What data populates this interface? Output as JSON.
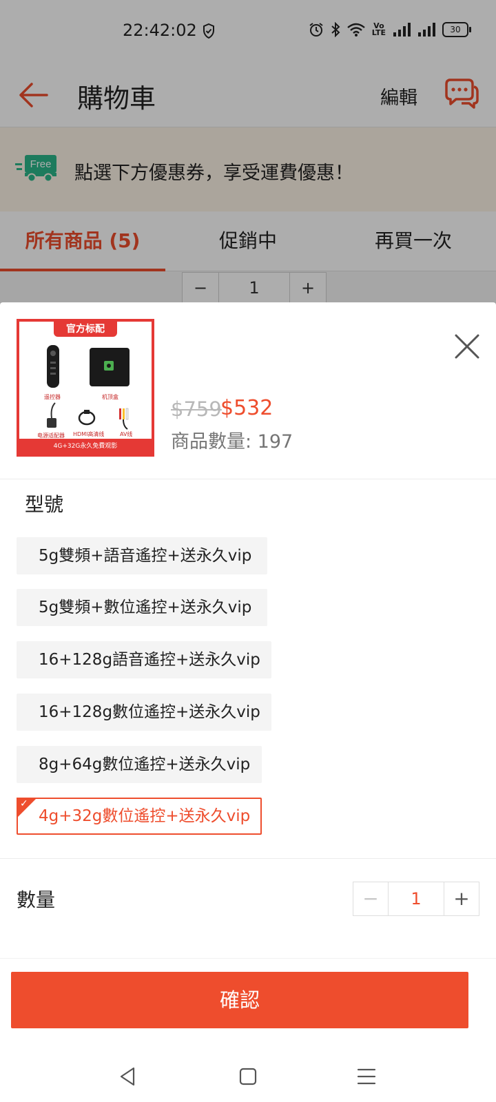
{
  "status_bar": {
    "time": "22:42:02",
    "battery": "30",
    "volte": "Vo\nLTE"
  },
  "app_bar": {
    "title": "購物車",
    "edit_label": "編輯"
  },
  "promo_banner": {
    "badge": "Free",
    "text": "點選下方優惠券，享受運費優惠！"
  },
  "tabs": [
    {
      "label": "所有商品 (5)",
      "active": true
    },
    {
      "label": "促銷中",
      "active": false
    },
    {
      "label": "再買一次",
      "active": false
    }
  ],
  "background_stepper": {
    "minus": "−",
    "value": "1",
    "plus": "+"
  },
  "sheet": {
    "product_image": {
      "tag": "官方标配",
      "footer": "4G+32G永久免費观影",
      "captions": [
        "遥控器",
        "机顶盒",
        "电源适配器",
        "HDMI高清线",
        "AV线"
      ]
    },
    "price_original": "$759",
    "price_current": "$532",
    "stock_text": "商品數量: 197",
    "variant_section_label": "型號",
    "variants": [
      {
        "label": "5g雙頻+語音遙控+送永久vip",
        "selected": false
      },
      {
        "label": "5g雙頻+數位遙控+送永久vip",
        "selected": false
      },
      {
        "label": "16+128g語音遙控+送永久vip",
        "selected": false
      },
      {
        "label": "16+128g數位遙控+送永久vip",
        "selected": false
      },
      {
        "label": "8g+64g數位遙控+送永久vip",
        "selected": false
      },
      {
        "label": "4g+32g數位遙控+送永久vip",
        "selected": true
      }
    ],
    "quantity_label": "數量",
    "quantity": {
      "minus": "−",
      "value": "1",
      "plus": "+"
    },
    "confirm_label": "確認"
  },
  "colors": {
    "accent": "#ee4d2d",
    "image_red": "#e53935",
    "banner_bg": "#fdf3e6",
    "free_badge": "#2bb58a"
  },
  "icons": [
    "back-arrow-icon",
    "chat-icon",
    "free-shipping-truck-icon",
    "close-icon",
    "check-icon",
    "nav-back-icon",
    "nav-home-icon",
    "nav-menu-icon"
  ]
}
